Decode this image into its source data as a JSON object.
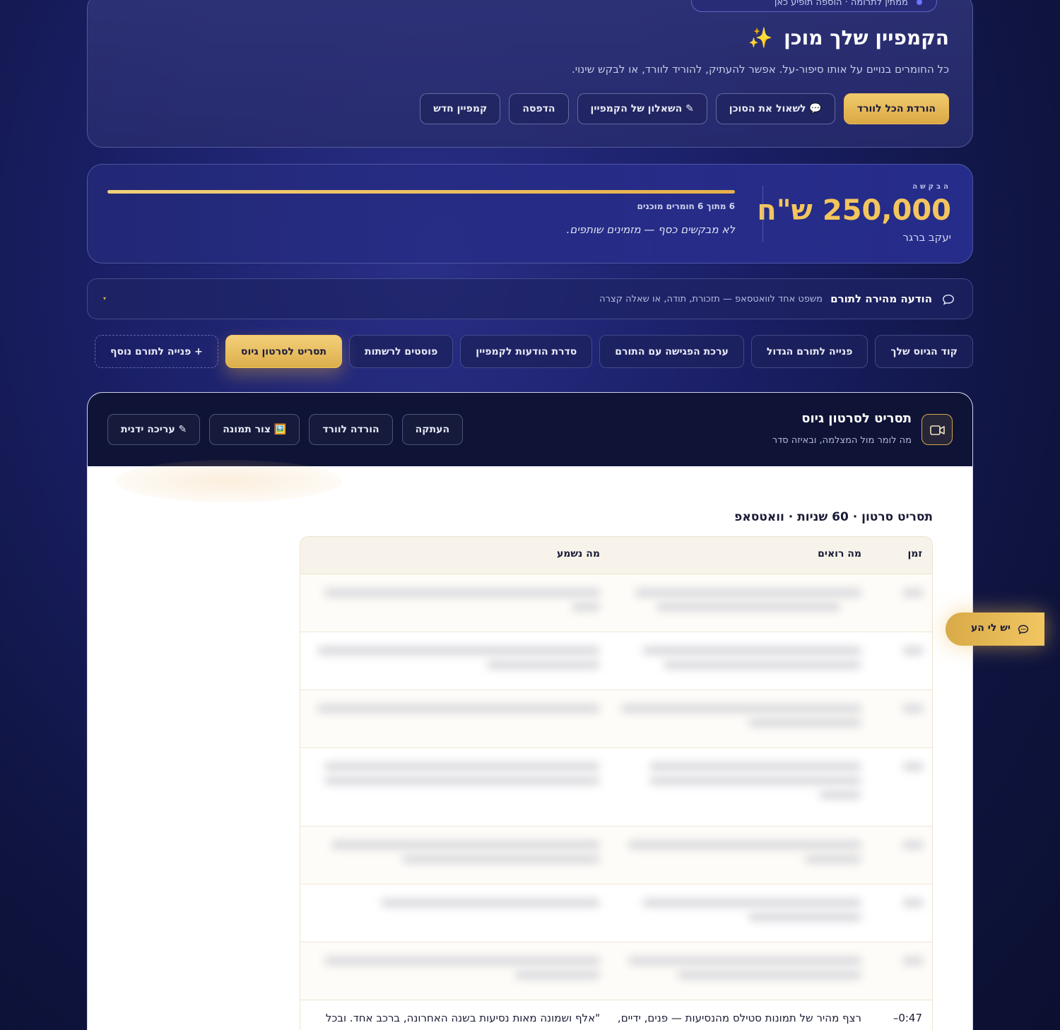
{
  "hero": {
    "pill_text": "ממתין לתרומה · הוספה תופיע כאן",
    "title": "הקמפיין שלך מוכן",
    "sparkle": "✨",
    "subtitle": "כל החומרים בנויים על אותו סיפור-על. אפשר להעתיק, להוריד לוורד, או לבקש שינוי.",
    "actions": [
      {
        "label": "הורדת הכל לוורד"
      },
      {
        "label": "💬 לשאול את הסוכן"
      },
      {
        "label": "✎ השאלון של הקמפיין"
      },
      {
        "label": "הדפסה"
      },
      {
        "label": "קמפיין חדש"
      }
    ]
  },
  "request": {
    "label": "הבקשה",
    "amount": "250,000 ש\"ח",
    "name": "יעקב ברגר",
    "progress_fraction": 1.0,
    "progress_text": "6 מתוך 6 חומרים מוכנים",
    "quote": "לא מבקשים כסף — מזמינים שותפים."
  },
  "quick": {
    "title": "הודעה מהירה לתורם",
    "hint": "משפט אחד לוואטסאפ — תזכורת, תודה, או שאלה קצרה",
    "caret": "▾"
  },
  "tabs": [
    {
      "label": "קוד הגיוס שלך"
    },
    {
      "label": "פנייה לתורם הגדול"
    },
    {
      "label": "ערכת הפגישה עם התורם"
    },
    {
      "label": "סדרת הודעות לקמפיין"
    },
    {
      "label": "פוסטים לרשתות"
    },
    {
      "label": "תסריט לסרטון גיוס"
    },
    {
      "label": "+ פנייה לתורם נוסף"
    }
  ],
  "panel": {
    "title": "תסריט לסרטון גיוס",
    "subtitle": "מה לומר מול המצלמה, ובאיזה סדר",
    "actions": [
      {
        "label": "העתקה"
      },
      {
        "label": "הורדה לוורד"
      },
      {
        "label": "🖼️ צור תמונה"
      },
      {
        "label": "✎ עריכה ידנית"
      }
    ]
  },
  "script": {
    "title": "תסריט סרטון · 60 שניות · וואטסאפ",
    "headers": {
      "time": "זמן",
      "see": "מה רואים",
      "hear": "מה נשמע"
    },
    "last_row": {
      "time": "0:47–",
      "see": "רצף מהיר של תמונות סטילס מהנסיעות — פנים, ידיים,",
      "hear": "\"אלף ושמונה מאות נסיעות בשנה האחרונה, ברכב אחד. ובכל"
    }
  },
  "float": {
    "label": "יש לי הע"
  },
  "colors": {
    "accent_gold": "#f3c55c",
    "navy": "#0f1436"
  }
}
